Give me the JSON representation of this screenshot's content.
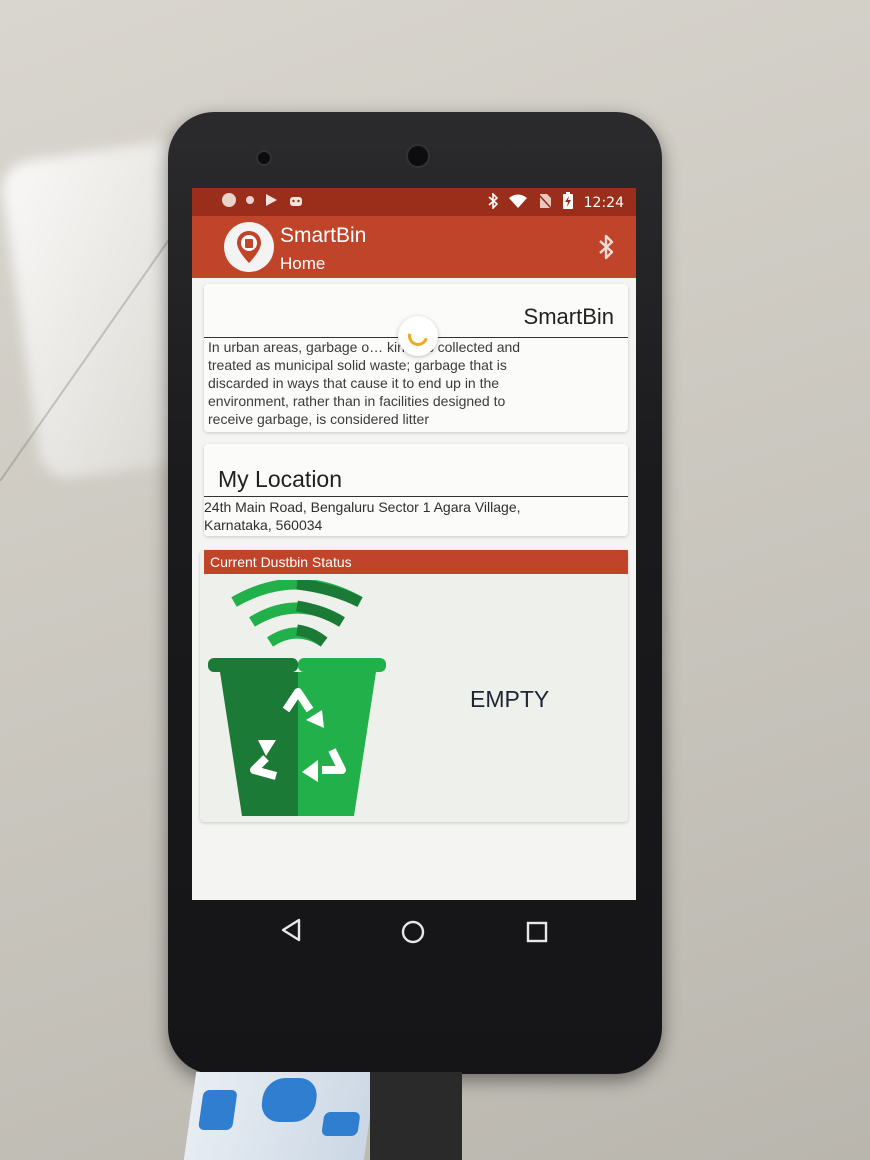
{
  "status_bar": {
    "time": "12:24",
    "icons": [
      "sync-icon",
      "circle-icon",
      "play-store-icon",
      "android-icon",
      "bluetooth-icon",
      "wifi-icon",
      "no-sim-icon",
      "battery-icon"
    ]
  },
  "app_bar": {
    "title": "SmartBin",
    "subtitle": "Home",
    "action_icon": "bluetooth-icon"
  },
  "intro_card": {
    "title": "SmartBin",
    "body_line1": "In urban areas, garbage o… kinds is collected and",
    "body_line2": "treated as municipal solid waste; garbage that is",
    "body_line3": "discarded in ways that cause it to end up in the",
    "body_line4": "environment, rather than in facilities designed to",
    "body_line5": "receive garbage, is considered litter"
  },
  "location_card": {
    "title": "My Location",
    "address_line1": "24th Main Road, Bengaluru Sector 1 Agara Village,",
    "address_line2": "Karnataka, 560034"
  },
  "status_card": {
    "header": "Current Dustbin Status",
    "status": "EMPTY",
    "colors": {
      "bin_dark": "#1b7a35",
      "bin_light": "#22b04a",
      "header_bg": "#c0442a"
    }
  },
  "nav": {
    "buttons": [
      "back-icon",
      "home-icon",
      "recents-icon"
    ]
  },
  "colors": {
    "appbar": "#c0442a",
    "statusbar": "#9b2e1a",
    "spinner": "#f2a81d"
  }
}
